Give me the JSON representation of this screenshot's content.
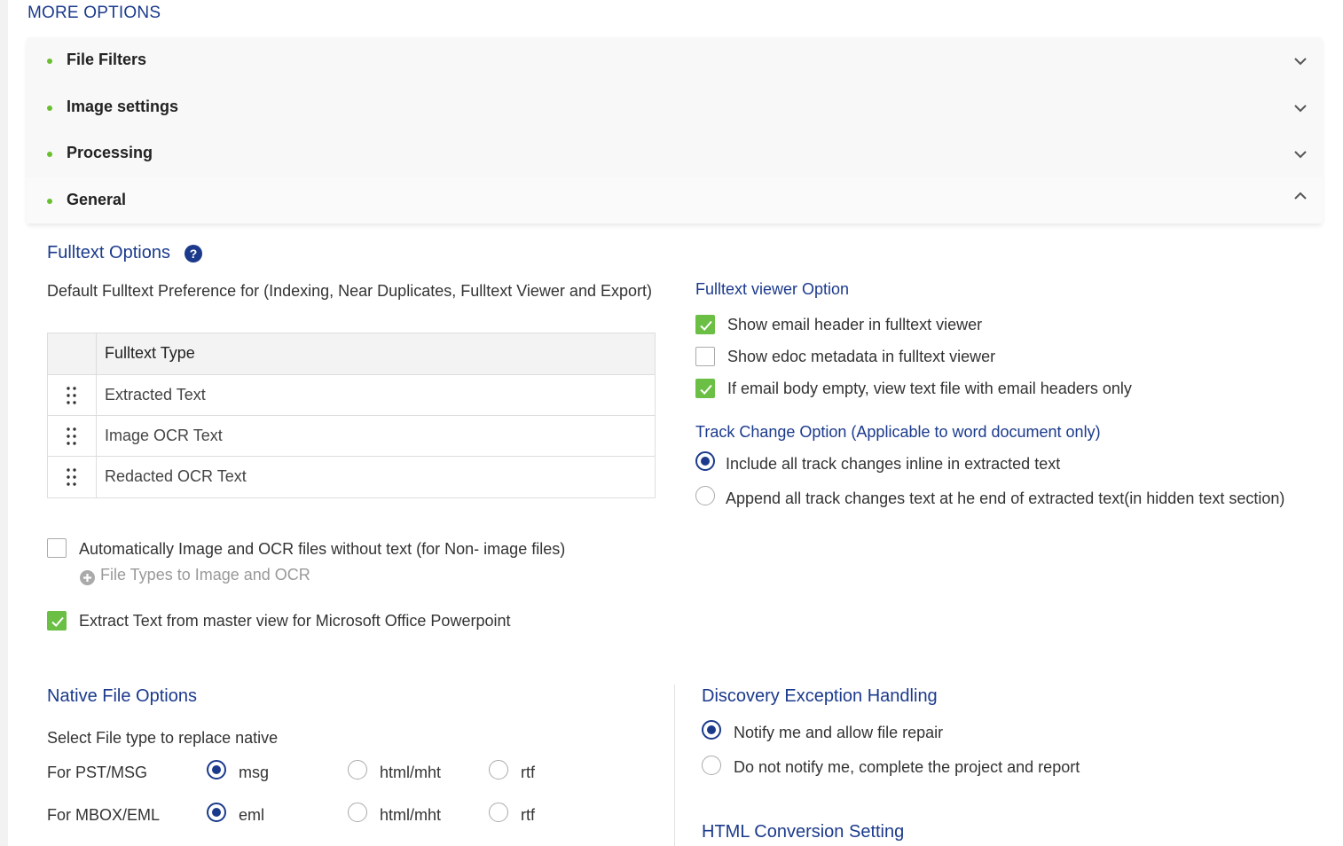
{
  "more_options_title": "MORE OPTIONS",
  "accordion": [
    {
      "label": "File Filters",
      "state": "collapsed"
    },
    {
      "label": "Image settings",
      "state": "collapsed"
    },
    {
      "label": "Processing",
      "state": "collapsed"
    },
    {
      "label": "General",
      "state": "expanded"
    }
  ],
  "fulltext": {
    "title": "Fulltext Options",
    "default_pref_label": "Default Fulltext Preference for (Indexing, Near Duplicates, Fulltext Viewer and Export)",
    "table_header": "Fulltext Type",
    "rows": [
      "Extracted Text",
      "Image OCR Text",
      "Redacted OCR Text"
    ],
    "auto_image_ocr": {
      "label": "Automatically Image and OCR files without text (for Non- image files)",
      "checked": false
    },
    "file_types_link": "File Types to Image and OCR",
    "extract_master": {
      "label": "Extract Text from master view for Microsoft Office Powerpoint",
      "checked": true
    }
  },
  "viewer_option": {
    "title": "Fulltext viewer Option",
    "items": [
      {
        "label": "Show email header in fulltext viewer",
        "checked": true
      },
      {
        "label": "Show edoc metadata in fulltext viewer",
        "checked": false
      },
      {
        "label": "If email body empty, view text file with email headers only",
        "checked": true
      }
    ]
  },
  "track_change": {
    "title": "Track Change Option (Applicable to word document only)",
    "options": [
      {
        "label": "Include all track changes inline in extracted text",
        "selected": true
      },
      {
        "label": "Append all track changes text at he end of extracted text(in hidden text section)",
        "selected": false
      }
    ]
  },
  "native": {
    "title": "Native File Options",
    "subtitle": "Select File type to replace native",
    "rows": [
      {
        "label": "For PST/MSG",
        "options": [
          "msg",
          "html/mht",
          "rtf"
        ],
        "selected": 0
      },
      {
        "label": "For MBOX/EML",
        "options": [
          "eml",
          "html/mht",
          "rtf"
        ],
        "selected": 0
      }
    ]
  },
  "discovery": {
    "title": "Discovery Exception Handling",
    "options": [
      {
        "label": "Notify me and allow file repair",
        "selected": true
      },
      {
        "label": "Do not notify me, complete the project and report",
        "selected": false
      }
    ]
  },
  "html_conversion": {
    "title": "HTML Conversion Setting"
  },
  "colors": {
    "accent": "#1b3a8c",
    "check": "#6abf44",
    "bullet": "#6abf2e"
  }
}
